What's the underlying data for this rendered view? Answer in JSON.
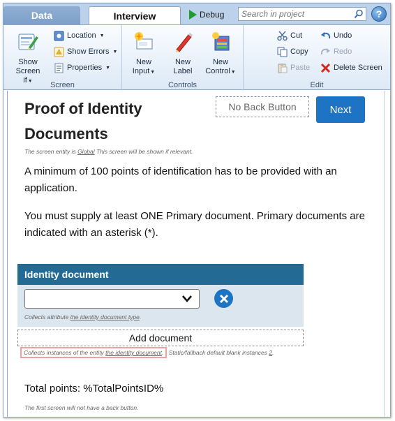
{
  "tabs": {
    "data": "Data",
    "interview": "Interview"
  },
  "toolbar": {
    "debug_label": "Debug",
    "search_placeholder": "Search in project",
    "help_label": "?"
  },
  "ribbon": {
    "screen_group": {
      "label": "Screen",
      "show_screen_if_line1": "Show",
      "show_screen_if_line2": "Screen if",
      "location": "Location",
      "show_errors": "Show Errors",
      "properties": "Properties"
    },
    "controls_group": {
      "label": "Controls",
      "new_input_line1": "New",
      "new_input_line2": "Input",
      "new_label_line1": "New",
      "new_label_line2": "Label",
      "new_control_line1": "New",
      "new_control_line2": "Control"
    },
    "edit_group": {
      "label": "Edit",
      "cut": "Cut",
      "copy": "Copy",
      "paste": "Paste",
      "undo": "Undo",
      "redo": "Redo",
      "delete_screen": "Delete Screen"
    }
  },
  "screen": {
    "title": "Proof of Identity Documents",
    "no_back_button": "No Back Button",
    "next_button": "Next",
    "entity_note_prefix": "The screen entity is ",
    "entity_note_link": "Global",
    "entity_note_suffix": "  This screen will be shown if relevant.",
    "para1": "A minimum of 100 points of identification has to be provided with an application.",
    "para2": "You must supply at least ONE Primary document. Primary documents are indicated with an asterisk (*).",
    "panel_title": "Identity document",
    "attr_note_prefix": "Collects attribute ",
    "attr_note_link": "the identity document type",
    "attr_note_suffix": ".",
    "add_document": "Add document",
    "inst_note_prefix": "Collects instances of the entity ",
    "inst_note_link": "the identity document",
    "inst_note_dot": ".",
    "inst_note_suffix": " Static/fallback default blank instances ",
    "inst_note_count": "2",
    "inst_note_end": ".",
    "total_points": "Total points: %TotalPointsID%",
    "first_screen_note": "The first screen will not have a back button."
  }
}
